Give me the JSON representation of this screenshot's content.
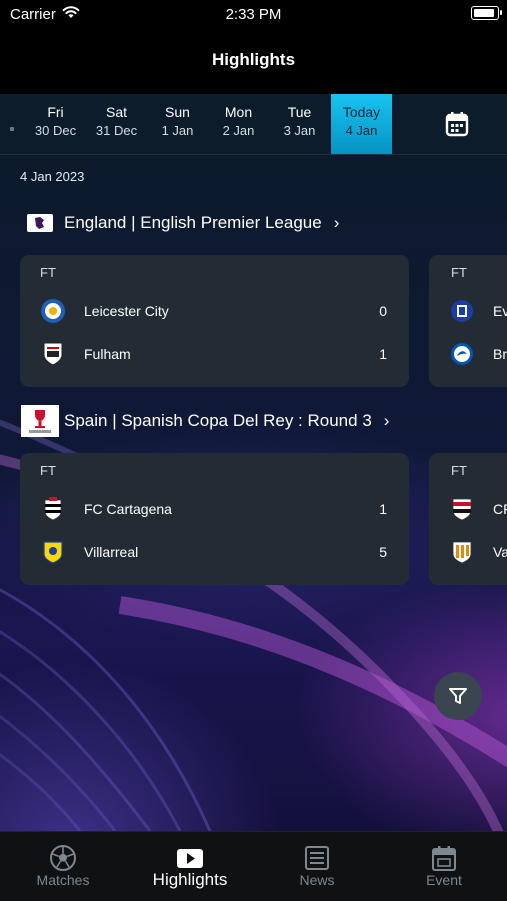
{
  "status_bar": {
    "carrier": "Carrier",
    "time": "2:33 PM"
  },
  "header": {
    "title": "Highlights"
  },
  "date_strip": {
    "dates": [
      {
        "day": "Fri",
        "date": "30 Dec"
      },
      {
        "day": "Sat",
        "date": "31 Dec"
      },
      {
        "day": "Sun",
        "date": "1 Jan"
      },
      {
        "day": "Mon",
        "date": "2 Jan"
      },
      {
        "day": "Tue",
        "date": "3 Jan"
      },
      {
        "day": "Today",
        "date": "4 Jan"
      }
    ],
    "selected": "Today"
  },
  "current_date": "4 Jan 2023",
  "leagues": [
    {
      "title": "England | English Premier League",
      "chevron": "›",
      "matches": [
        {
          "status": "FT",
          "home": {
            "name": "Leicester City",
            "score": "0"
          },
          "away": {
            "name": "Fulham",
            "score": "1"
          }
        },
        {
          "status": "FT",
          "home": {
            "name": "Ev",
            "score": ""
          },
          "away": {
            "name": "Br",
            "score": ""
          }
        }
      ]
    },
    {
      "title": "Spain | Spanish Copa Del Rey : Round 3",
      "chevron": "›",
      "matches": [
        {
          "status": "FT",
          "home": {
            "name": "FC Cartagena",
            "score": "1"
          },
          "away": {
            "name": "Villarreal",
            "score": "5"
          }
        },
        {
          "status": "FT",
          "home": {
            "name": "CF",
            "score": ""
          },
          "away": {
            "name": "Va",
            "score": ""
          }
        }
      ]
    }
  ],
  "tab_bar": {
    "tabs": [
      {
        "label": "Matches",
        "icon": "soccer-ball-icon"
      },
      {
        "label": "Highlights",
        "icon": "play-icon"
      },
      {
        "label": "News",
        "icon": "news-icon"
      },
      {
        "label": "Event",
        "icon": "calendar-icon"
      }
    ],
    "active": "Highlights"
  },
  "colors": {
    "accent": "#19c3ef",
    "card": "#232c35",
    "tab_inactive": "#7d8891"
  }
}
